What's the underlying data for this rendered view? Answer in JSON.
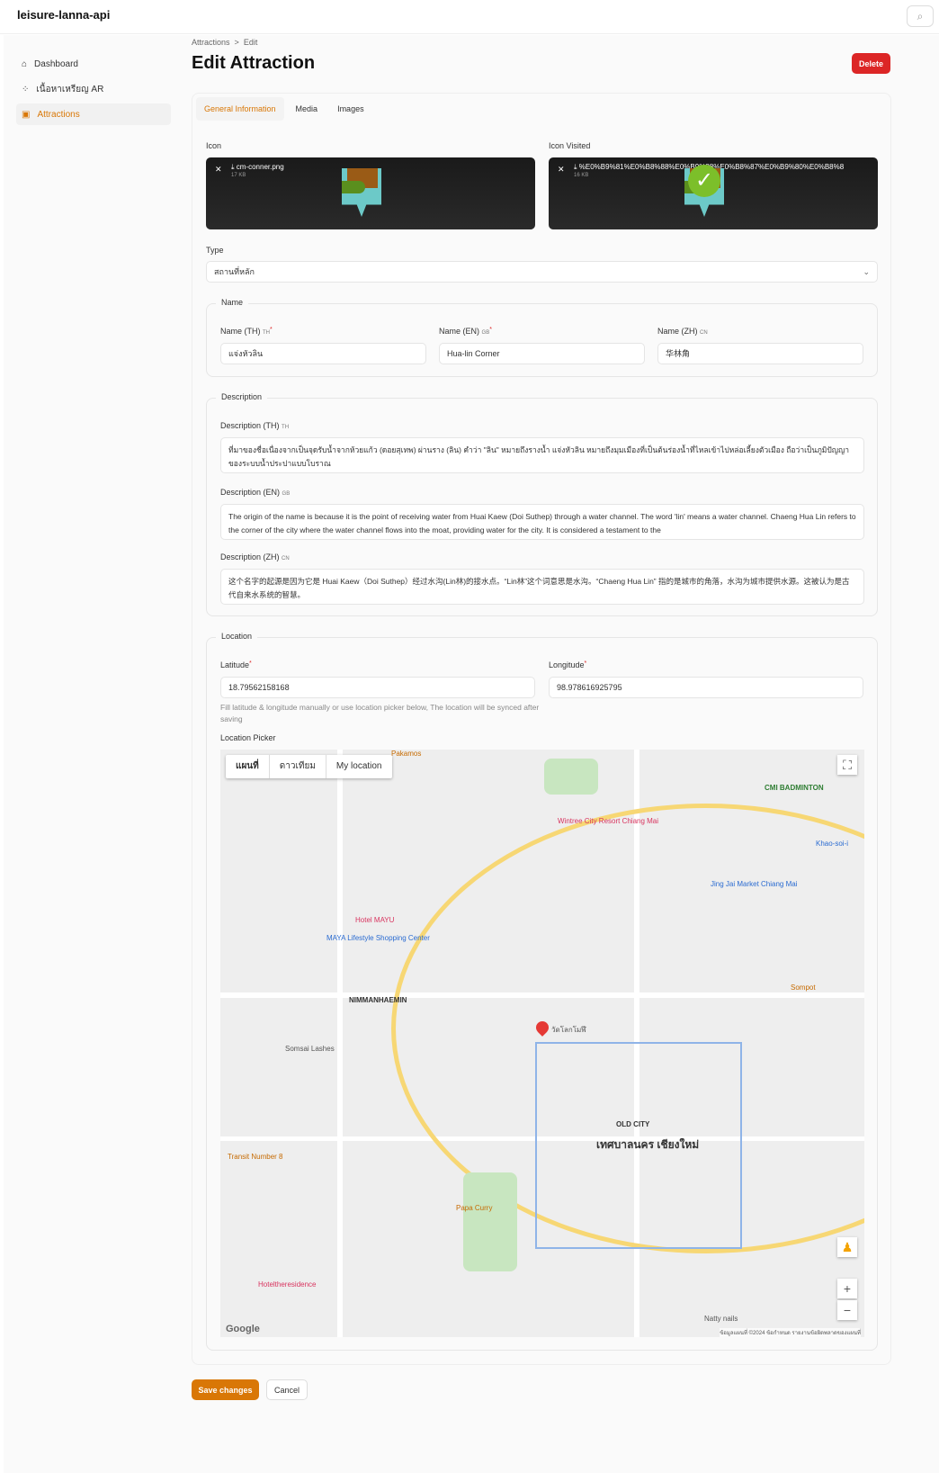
{
  "app": {
    "title": "leisure-lanna-api",
    "search_icon": "search-icon"
  },
  "sidebar": {
    "items": [
      {
        "label": "Dashboard",
        "icon": "home-icon"
      },
      {
        "label": "เนื้อหาเหรียญ AR",
        "icon": "ar-icon"
      },
      {
        "label": "Attractions",
        "icon": "building-icon",
        "active": true
      }
    ]
  },
  "header": {
    "breadcrumb": [
      "Attractions",
      ">",
      "Edit"
    ],
    "title": "Edit Attraction",
    "delete_label": "Delete"
  },
  "tabs": [
    "General Information",
    "Media",
    "Images"
  ],
  "form": {
    "icon_label": "Icon",
    "icon_file": "cm-conner.png",
    "icon_size": "17 KB",
    "icon_visited_label": "Icon Visited",
    "icon_visited_file": "%E0%B9%81%E0%B8%88%E0%B9%88%E0%B8%87%E0%B9%80%E0%B8%8...",
    "icon_visited_size": "16 KB",
    "type_label": "Type",
    "type_value": "สถานที่หลัก",
    "name_legend": "Name",
    "name_th_label": "Name (TH)",
    "name_th_flag": "TH",
    "name_th_value": "แจ่งหัวลิน",
    "name_en_label": "Name (EN)",
    "name_en_flag": "GB",
    "name_en_value": "Hua-lin Corner",
    "name_zh_label": "Name (ZH)",
    "name_zh_flag": "CN",
    "name_zh_value": "华林角",
    "desc_legend": "Description",
    "desc_th_label": "Description (TH)",
    "desc_th_flag": "TH",
    "desc_th_value": "ที่มาของชื่อเนื่องจากเป็นจุดรับน้ำจากห้วยแก้ว (ดอยสุเทพ) ผ่านราง (ลิน) คำว่า \"ลิน\" หมายถึงรางน้ำ แจ่งหัวลิน หมายถึงมุมเมืองที่เป็นต้นร่องน้ำที่ไหลเข้าไปหล่อเลี้ยงตัวเมือง ถือว่าเป็นภูมิปัญญาของระบบน้ำประปาแบบโบราณ",
    "desc_en_label": "Description (EN)",
    "desc_en_flag": "GB",
    "desc_en_value": "The origin of the name is because it is the point of receiving water from Huai Kaew (Doi Suthep) through a water channel. The word 'lin' means a water channel. Chaeng Hua Lin refers to the corner of the city where the water channel flows into the moat, providing water for the city. It is considered a testament to the",
    "desc_zh_label": "Description (ZH)",
    "desc_zh_flag": "CN",
    "desc_zh_value": "这个名字的起源是因为它是 Huai Kaew（Doi Suthep）经过水沟(Lin林)的接水点。“Lin林”这个词意思是水沟。“Chaeng Hua Lin” 指的是城市的角落，水沟为城市提供水源。这被认为是古代自来水系统的智慧。",
    "loc_legend": "Location",
    "lat_label": "Latitude",
    "lat_value": "18.79562158168",
    "lng_label": "Longitude",
    "lng_value": "98.978616925795",
    "loc_help": "Fill latitude & longitude manually or use location picker below, The location will be synced after saving",
    "picker_label": "Location Picker"
  },
  "map": {
    "type_buttons": [
      "แผนที่",
      "ดาวเทียม",
      "My location"
    ],
    "labels": [
      "Pakamos",
      "CMI BADMINTON",
      "Wintree City Resort Chiang Mai",
      "Hotel MAYU",
      "MAYA Lifestyle Shopping Center",
      "NIMMANHAEMIN",
      "Jing Jai Market Chiang Mai",
      "Khao-soi-i",
      "Somsai Lashes",
      "Transit Number 8",
      "OLD CITY",
      "เทศบาลนคร เชียงใหม่",
      "Papa Curry",
      "Hoteltheresidence",
      "Sompot",
      "วัดโลกโมฬี",
      "Natty nails"
    ],
    "google": "Google",
    "attribution": "ข้อมูลแผนที่ ©2024  ข้อกำหนด  รายงานข้อผิดพลาดของแผนที่",
    "zoom_in": "+",
    "zoom_out": "−"
  },
  "footer": {
    "save_label": "Save changes",
    "cancel_label": "Cancel"
  }
}
